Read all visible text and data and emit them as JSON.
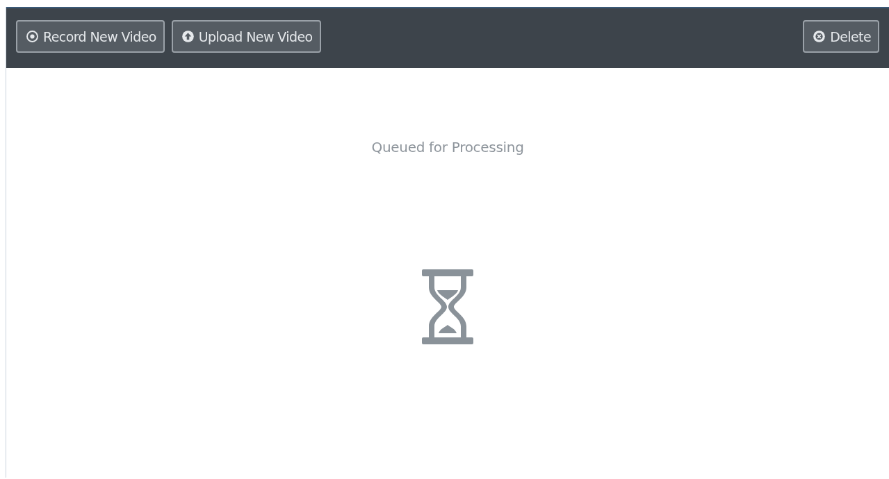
{
  "toolbar": {
    "left_buttons": [
      {
        "label": "Record New Video",
        "kind": "record"
      },
      {
        "label": "Upload New Video",
        "kind": "upload"
      }
    ],
    "right_buttons": [
      {
        "label": "Delete",
        "kind": "delete"
      }
    ]
  },
  "status": {
    "message": "Queued for Processing"
  }
}
